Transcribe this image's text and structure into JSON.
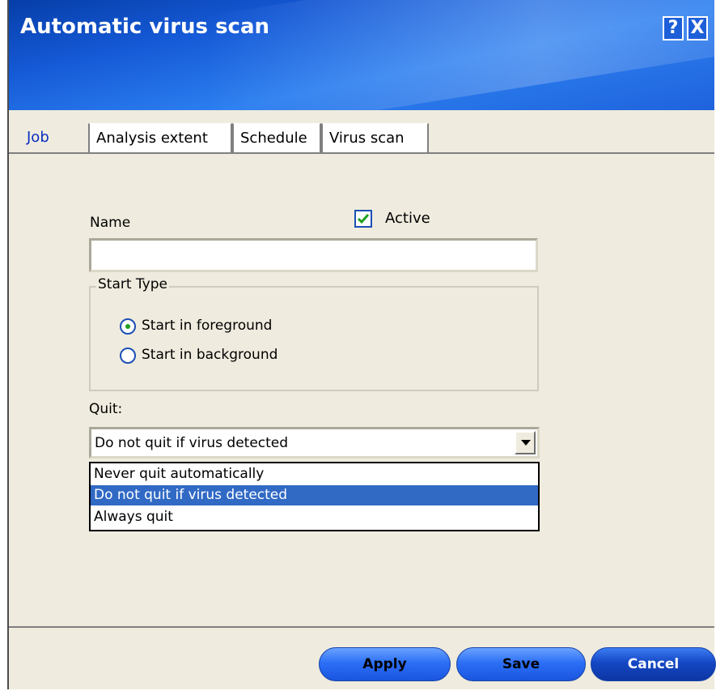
{
  "window": {
    "title": "Automatic virus scan",
    "help_label": "?",
    "close_label": "X"
  },
  "tabs": [
    {
      "label": "Job",
      "active": true
    },
    {
      "label": "Analysis extent",
      "active": false
    },
    {
      "label": "Schedule",
      "active": false
    },
    {
      "label": "Virus scan",
      "active": false
    }
  ],
  "job": {
    "name_label": "Name",
    "name_value": "",
    "active_label": "Active",
    "active_checked": true,
    "start_type": {
      "legend": "Start Type",
      "options": [
        {
          "label": "Start in foreground",
          "selected": true
        },
        {
          "label": "Start in background",
          "selected": false
        }
      ]
    },
    "quit": {
      "label": "Quit:",
      "selected": "Do not quit if virus detected",
      "options": [
        "Never quit automatically",
        "Do not quit if virus detected",
        "Always quit"
      ]
    }
  },
  "buttons": {
    "apply": "Apply",
    "save": "Save",
    "cancel": "Cancel"
  },
  "colors": {
    "header_blue": "#1559d6",
    "selection_blue": "#316ac5",
    "checkmark_green": "#20a020"
  }
}
